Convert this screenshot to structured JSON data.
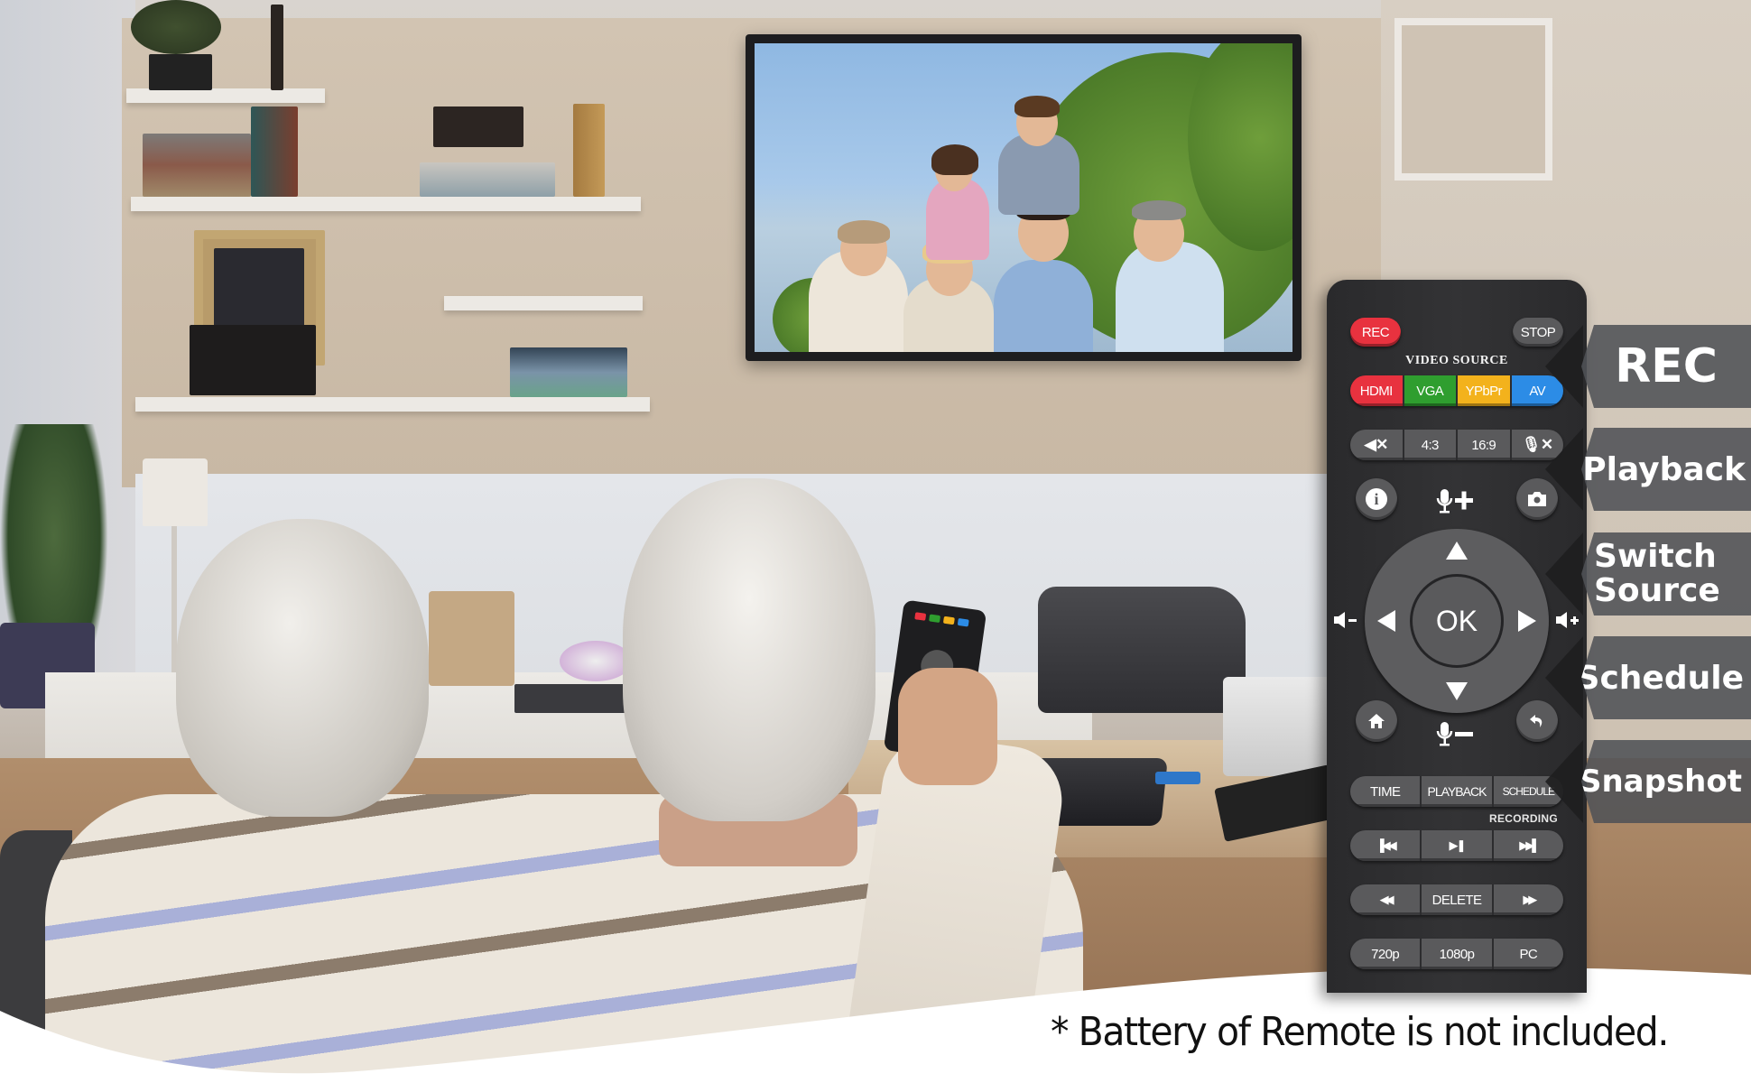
{
  "scene": {
    "description": "Senior couple on sofa watching family photo on wall TV, man holding remote; video capture box, VCR, VHS tape and camcorder on table",
    "tv_content": "family-photo"
  },
  "remote": {
    "rec_label": "REC",
    "stop_label": "STOP",
    "video_source_label": "VIDEO SOURCE",
    "sources": [
      {
        "label": "HDMI",
        "color": "#e8323f"
      },
      {
        "label": "VGA",
        "color": "#2f9e2f"
      },
      {
        "label": "YPbPr",
        "color": "#f3b21c"
      },
      {
        "label": "AV",
        "color": "#2c8ce6"
      }
    ],
    "row2": [
      {
        "icon": "speaker-mute-icon",
        "label": ""
      },
      {
        "label": "4:3"
      },
      {
        "label": "16:9"
      },
      {
        "icon": "mic-mute-icon",
        "label": ""
      }
    ],
    "mic_up_icon": "mic-plus-icon",
    "mic_down_icon": "mic-minus-icon",
    "vol_down_icon": "volume-down-icon",
    "vol_up_icon": "volume-up-icon",
    "info_icon": "info-icon",
    "camera_icon": "camera-icon",
    "home_icon": "home-icon",
    "back_icon": "back-icon",
    "ok_label": "OK",
    "function_row": [
      "TIME",
      "PLAYBACK",
      "SCHEDULE"
    ],
    "recording_label": "RECORDING",
    "transport_row": [
      "skip-previous-icon",
      "play-pause-icon",
      "skip-next-icon"
    ],
    "edit_row": [
      {
        "icon": "rewind-icon"
      },
      {
        "label": "DELETE"
      },
      {
        "icon": "fast-forward-icon"
      }
    ],
    "resolution_row": [
      "720p",
      "1080p",
      "PC"
    ],
    "rec_color": "#e8323f",
    "body_color": "#2e2e30"
  },
  "callouts": [
    {
      "label": "REC"
    },
    {
      "label": "Playback"
    },
    {
      "label": "Switch Source"
    },
    {
      "label": "Schedule"
    },
    {
      "label": "Snapshot"
    }
  ],
  "footnote": "* Battery of Remote is not included."
}
